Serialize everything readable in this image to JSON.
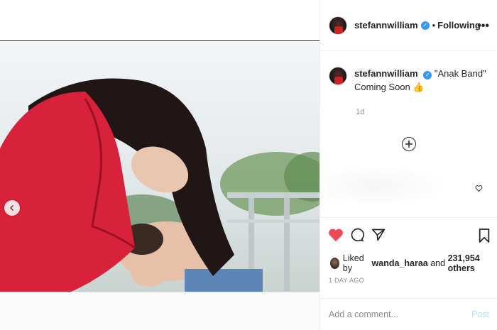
{
  "post": {
    "username": "stefannwilliam",
    "follow_separator": "•",
    "follow_label": "Following",
    "more_label": "•••",
    "caption_user": "stefannwilliam",
    "caption_line1": "\"Anak Band\"",
    "caption_line2": "Coming Soon 👍",
    "time_ago": "1d",
    "likes_prefix": "Liked by",
    "likes_user": "wanda_haraa",
    "likes_and": "and",
    "likes_count": "231,954 others",
    "posted_date": "1 DAY AGO",
    "comment_placeholder": "Add a comment...",
    "post_label": "Post"
  },
  "colors": {
    "like_red": "#ed4956",
    "verified_blue": "#3897f0",
    "post_disabled": "#b2dffc"
  },
  "icons": {
    "prev": "chevron-left-icon",
    "load_more": "plus-circle-icon",
    "like": "heart-filled-icon",
    "comment": "comment-icon",
    "share": "paper-plane-icon",
    "save": "bookmark-icon"
  }
}
